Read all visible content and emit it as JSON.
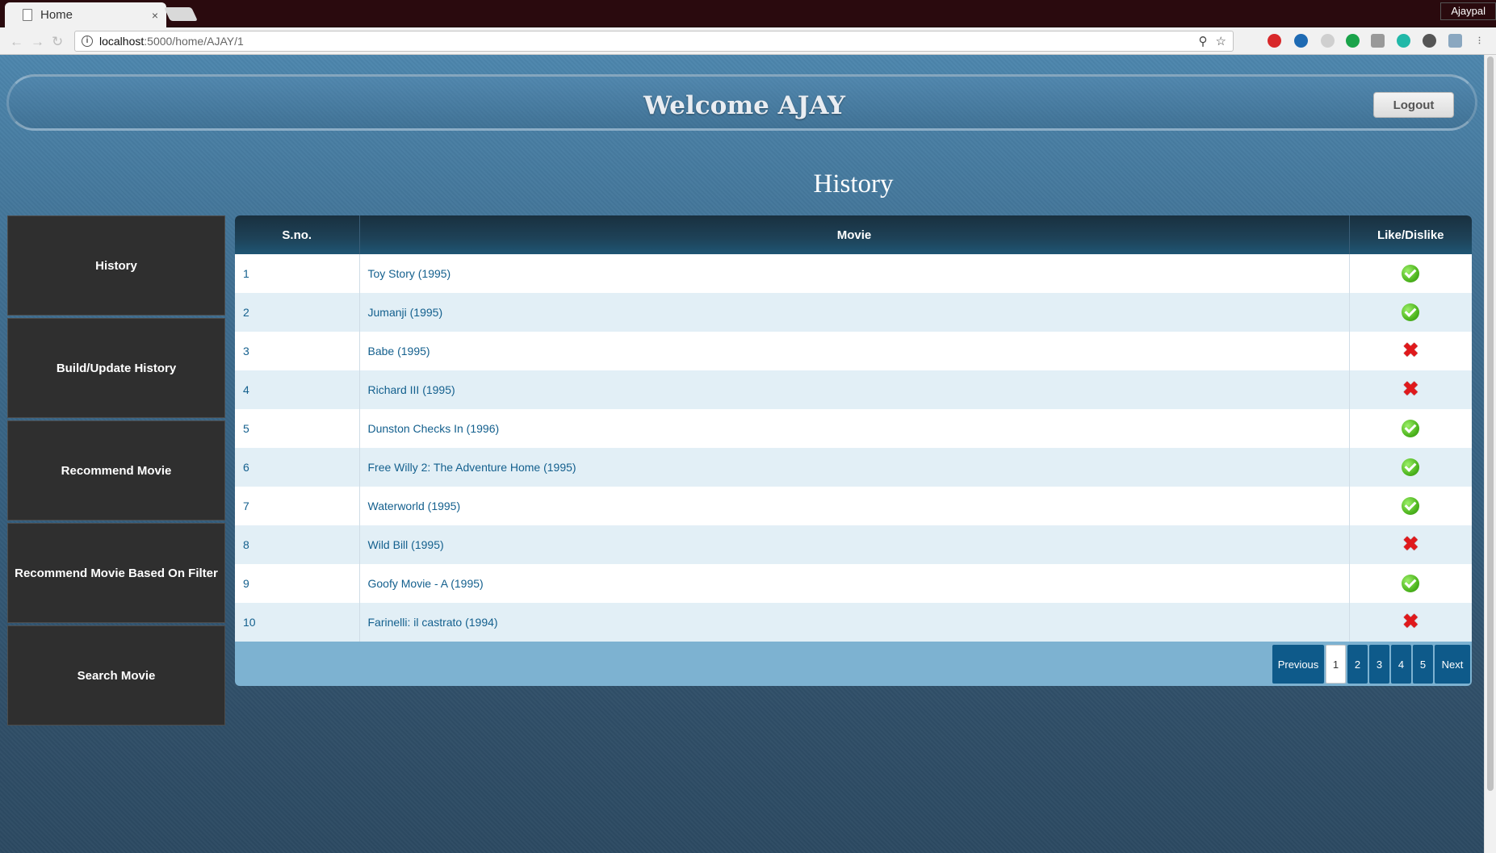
{
  "browser": {
    "tab_title": "Home",
    "tab_close": "×",
    "profile_name": "Ajaypal",
    "url_host": "localhost",
    "url_path": ":5000/home/AJAY/1"
  },
  "header": {
    "welcome": "Welcome AJAY",
    "logout_label": "Logout"
  },
  "section_title": "History",
  "sidebar": {
    "items": [
      {
        "label": "History"
      },
      {
        "label": "Build/Update History"
      },
      {
        "label": "Recommend Movie"
      },
      {
        "label": "Recommend Movie Based On Filter"
      },
      {
        "label": "Search Movie"
      }
    ]
  },
  "table": {
    "headers": {
      "sno": "S.no.",
      "movie": "Movie",
      "like": "Like/Dislike"
    },
    "rows": [
      {
        "sno": "1",
        "movie": "Toy Story (1995)",
        "liked": true
      },
      {
        "sno": "2",
        "movie": "Jumanji (1995)",
        "liked": true
      },
      {
        "sno": "3",
        "movie": "Babe (1995)",
        "liked": false
      },
      {
        "sno": "4",
        "movie": "Richard III (1995)",
        "liked": false
      },
      {
        "sno": "5",
        "movie": "Dunston Checks In (1996)",
        "liked": true
      },
      {
        "sno": "6",
        "movie": "Free Willy 2: The Adventure Home (1995)",
        "liked": true
      },
      {
        "sno": "7",
        "movie": "Waterworld (1995)",
        "liked": true
      },
      {
        "sno": "8",
        "movie": "Wild Bill (1995)",
        "liked": false
      },
      {
        "sno": "9",
        "movie": "Goofy Movie - A (1995)",
        "liked": true
      },
      {
        "sno": "10",
        "movie": "Farinelli: il castrato (1994)",
        "liked": false
      }
    ]
  },
  "pagination": {
    "previous_label": "Previous",
    "pages": [
      "1",
      "2",
      "3",
      "4",
      "5"
    ],
    "current_page": "1",
    "next_label": "Next"
  }
}
